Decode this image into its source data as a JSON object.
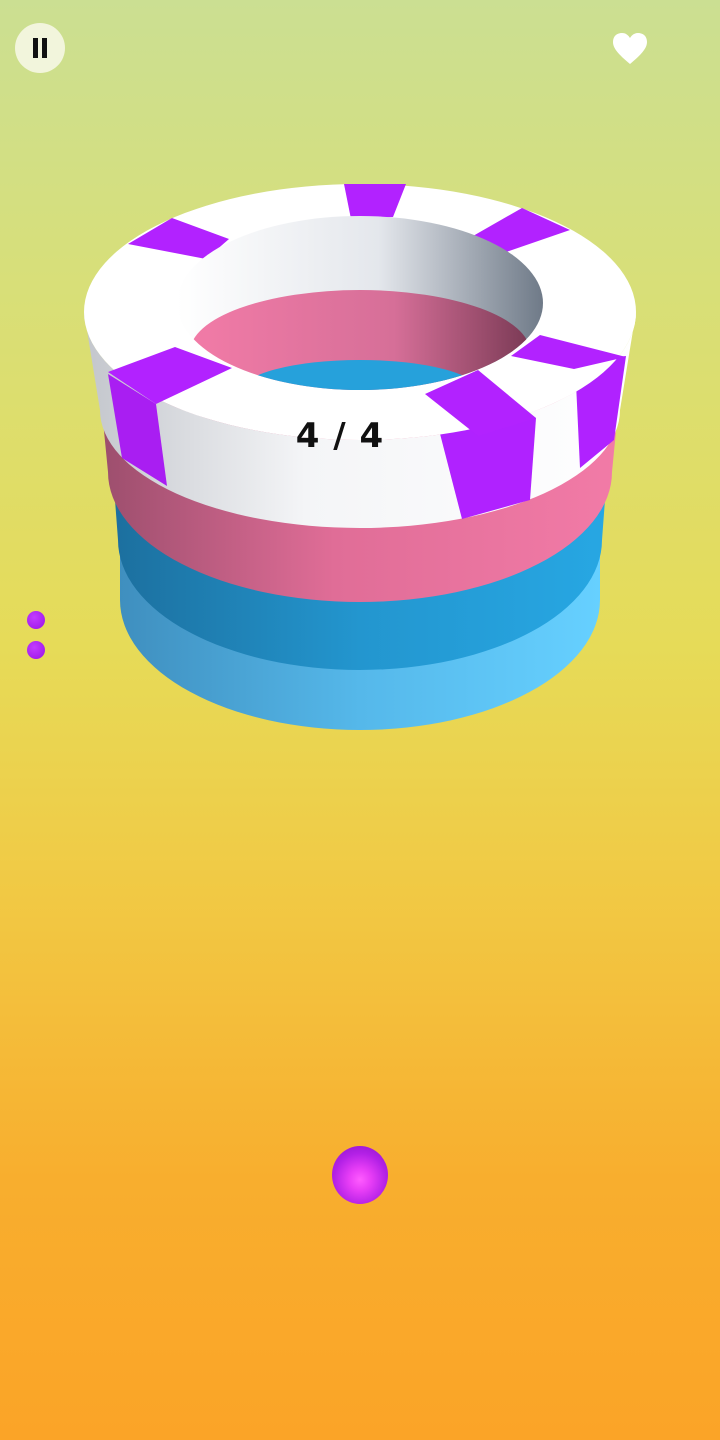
{
  "hud": {
    "pause_icon": "pause-icon",
    "lives_icon": "heart-icon",
    "counter_text": "4 / 4",
    "remaining_balls": 2
  },
  "colors": {
    "purple": "#b222ff",
    "pink": "#f07aa6",
    "blue": "#239fd8",
    "light_blue": "#61c9f8",
    "white": "#ffffff"
  },
  "tower": {
    "rings": [
      "white-purple",
      "pink",
      "blue",
      "light-blue"
    ]
  }
}
